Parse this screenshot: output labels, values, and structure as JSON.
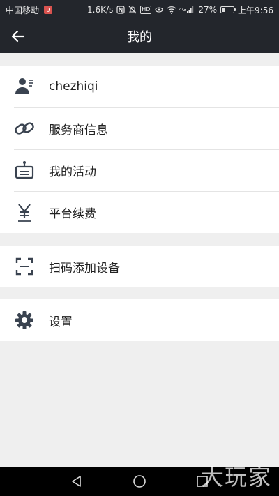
{
  "status_bar": {
    "carrier": "中国移动",
    "carrier_badge": "9",
    "speed": "1.6K/s",
    "network_badge": "4G",
    "hd_badge": "HD",
    "battery_percent": "27%",
    "battery_level": 0.27,
    "time": "上午9:56"
  },
  "header": {
    "title": "我的"
  },
  "menu_groups": [
    {
      "items": [
        {
          "label": "chezhiqi",
          "icon": "user-profile-icon"
        },
        {
          "label": "服务商信息",
          "icon": "link-icon"
        },
        {
          "label": "我的活动",
          "icon": "activity-icon"
        },
        {
          "label": "平台续费",
          "icon": "yen-icon"
        }
      ]
    },
    {
      "items": [
        {
          "label": "扫码添加设备",
          "icon": "scan-icon"
        }
      ]
    },
    {
      "items": [
        {
          "label": "设置",
          "icon": "gear-icon"
        }
      ]
    }
  ],
  "nav_bar": {
    "back": "back-triangle-icon",
    "home": "home-circle-icon",
    "recent": "recent-square-icon"
  },
  "watermark": "大玩家",
  "colors": {
    "bar": "#23262c",
    "background": "#efefef",
    "icon": "#3a4350"
  }
}
